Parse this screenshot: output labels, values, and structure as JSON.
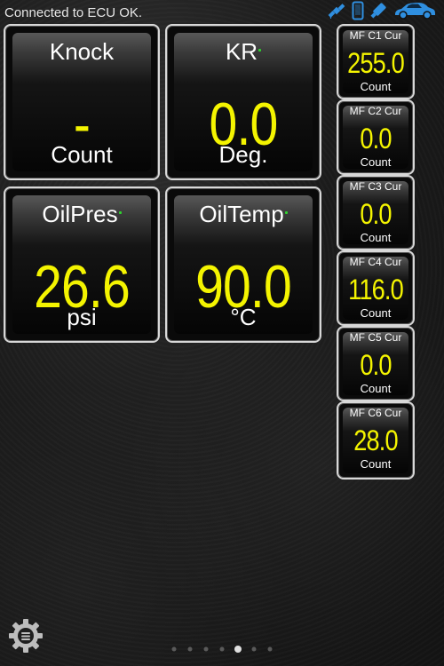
{
  "status": {
    "text": "Connected to ECU OK.",
    "icons": [
      "satellite-icon",
      "phone-icon",
      "bluetooth-dongle-icon",
      "car-icon"
    ],
    "icon_color": "#2f8fe0"
  },
  "gauges": [
    {
      "title": "Knock",
      "value": "-",
      "unit": "Count",
      "indicator": false
    },
    {
      "title": "KR",
      "value": "0.0",
      "unit": "Deg.",
      "indicator": true
    },
    {
      "title": "OilPres",
      "value": "26.6",
      "unit": "psi",
      "indicator": true
    },
    {
      "title": "OilTemp",
      "value": "90.0",
      "unit": "°C",
      "indicator": true
    }
  ],
  "mini_gauges": [
    {
      "title": "MF C1 Cur",
      "value": "255.0",
      "unit": "Count"
    },
    {
      "title": "MF C2 Cur",
      "value": "0.0",
      "unit": "Count"
    },
    {
      "title": "MF C3 Cur",
      "value": "0.0",
      "unit": "Count"
    },
    {
      "title": "MF C4 Cur",
      "value": "116.0",
      "unit": "Count"
    },
    {
      "title": "MF C5 Cur",
      "value": "0.0",
      "unit": "Count"
    },
    {
      "title": "MF C6 Cur",
      "value": "28.0",
      "unit": "Count"
    }
  ],
  "pager": {
    "pages": 7,
    "current": 5
  },
  "colors": {
    "value": "#f4f400",
    "indicator": "#2fd32f"
  }
}
